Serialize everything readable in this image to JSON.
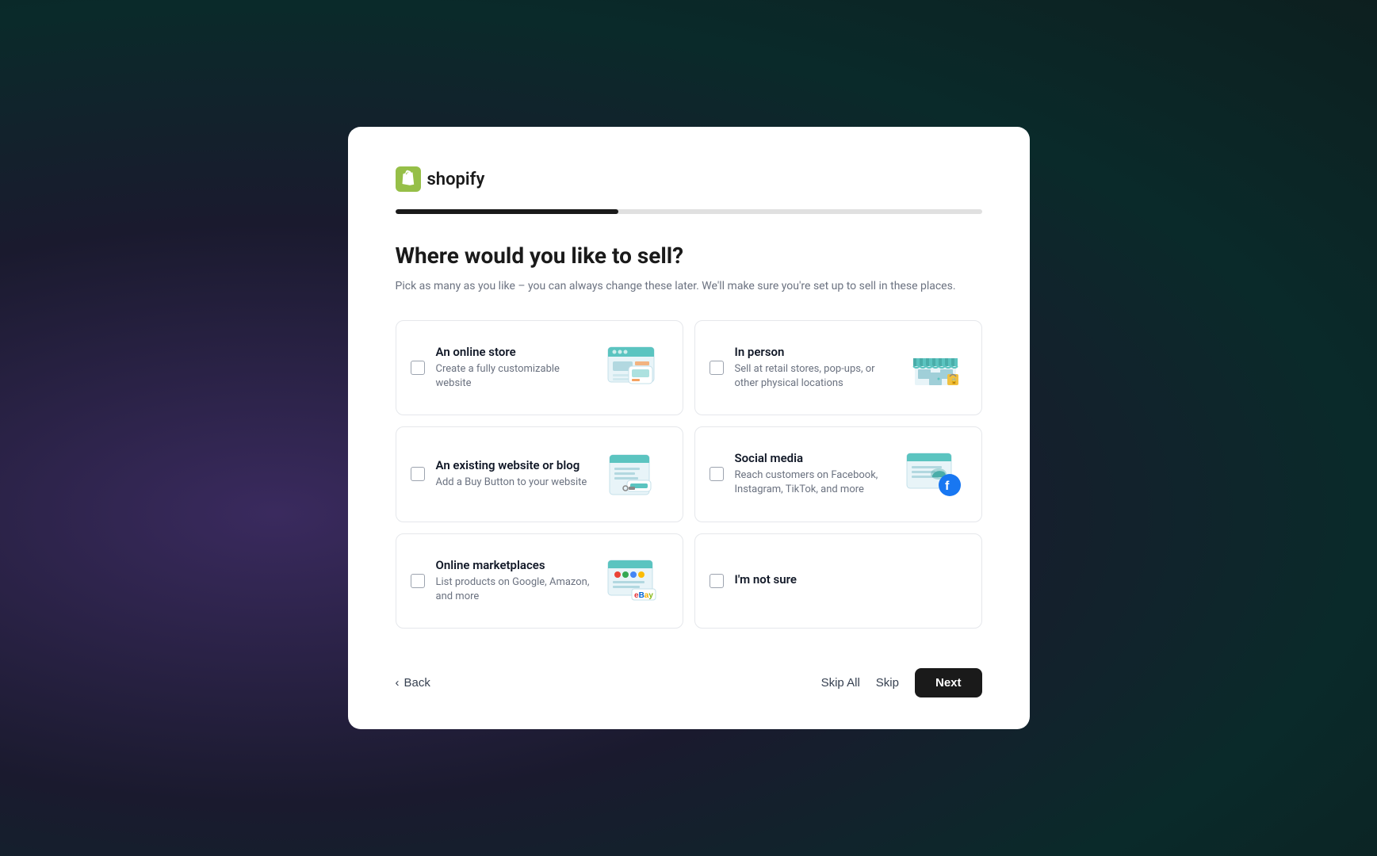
{
  "logo": {
    "text": "shopify"
  },
  "progress": {
    "percent": 38
  },
  "page": {
    "title": "Where would you like to sell?",
    "subtitle": "Pick as many as you like – you can always change these later. We'll make sure you're set up to sell in these places."
  },
  "options": [
    {
      "id": "online-store",
      "title": "An online store",
      "desc": "Create a fully customizable website",
      "checked": false
    },
    {
      "id": "in-person",
      "title": "In person",
      "desc": "Sell at retail stores, pop-ups, or other physical locations",
      "checked": false
    },
    {
      "id": "existing-website",
      "title": "An existing website or blog",
      "desc": "Add a Buy Button to your website",
      "checked": false
    },
    {
      "id": "social-media",
      "title": "Social media",
      "desc": "Reach customers on Facebook, Instagram, TikTok, and more",
      "checked": false
    },
    {
      "id": "online-marketplaces",
      "title": "Online marketplaces",
      "desc": "List products on Google, Amazon, and more",
      "checked": false
    },
    {
      "id": "not-sure",
      "title": "I'm not sure",
      "desc": "",
      "checked": false
    }
  ],
  "footer": {
    "back_label": "Back",
    "skip_all_label": "Skip All",
    "skip_label": "Skip",
    "next_label": "Next"
  }
}
